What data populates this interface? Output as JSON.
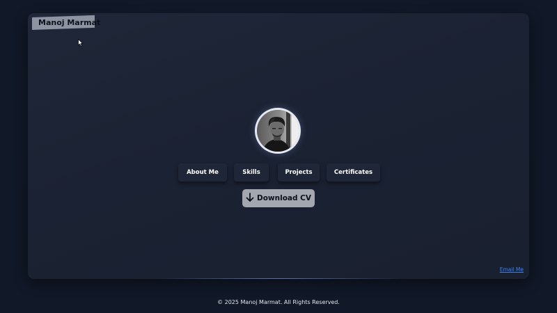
{
  "header": {
    "logo_text": "Manoj Marmat"
  },
  "profile": {
    "avatar_alt": "Profile photo"
  },
  "nav": {
    "items": [
      {
        "label": "About Me"
      },
      {
        "label": "Skills"
      },
      {
        "label": "Projects"
      },
      {
        "label": "Certificates"
      }
    ]
  },
  "actions": {
    "download_label": "Download CV",
    "download_icon": "arrow-down-icon"
  },
  "contact": {
    "email_label": "Email Me"
  },
  "footer": {
    "copyright": "© 2025 Manoj Marmat. All Rights Reserved."
  },
  "colors": {
    "page_bg": "#111827",
    "card_bg": "#1e2637",
    "link": "#3b82f6",
    "download_bg": "#a3a7b0"
  }
}
